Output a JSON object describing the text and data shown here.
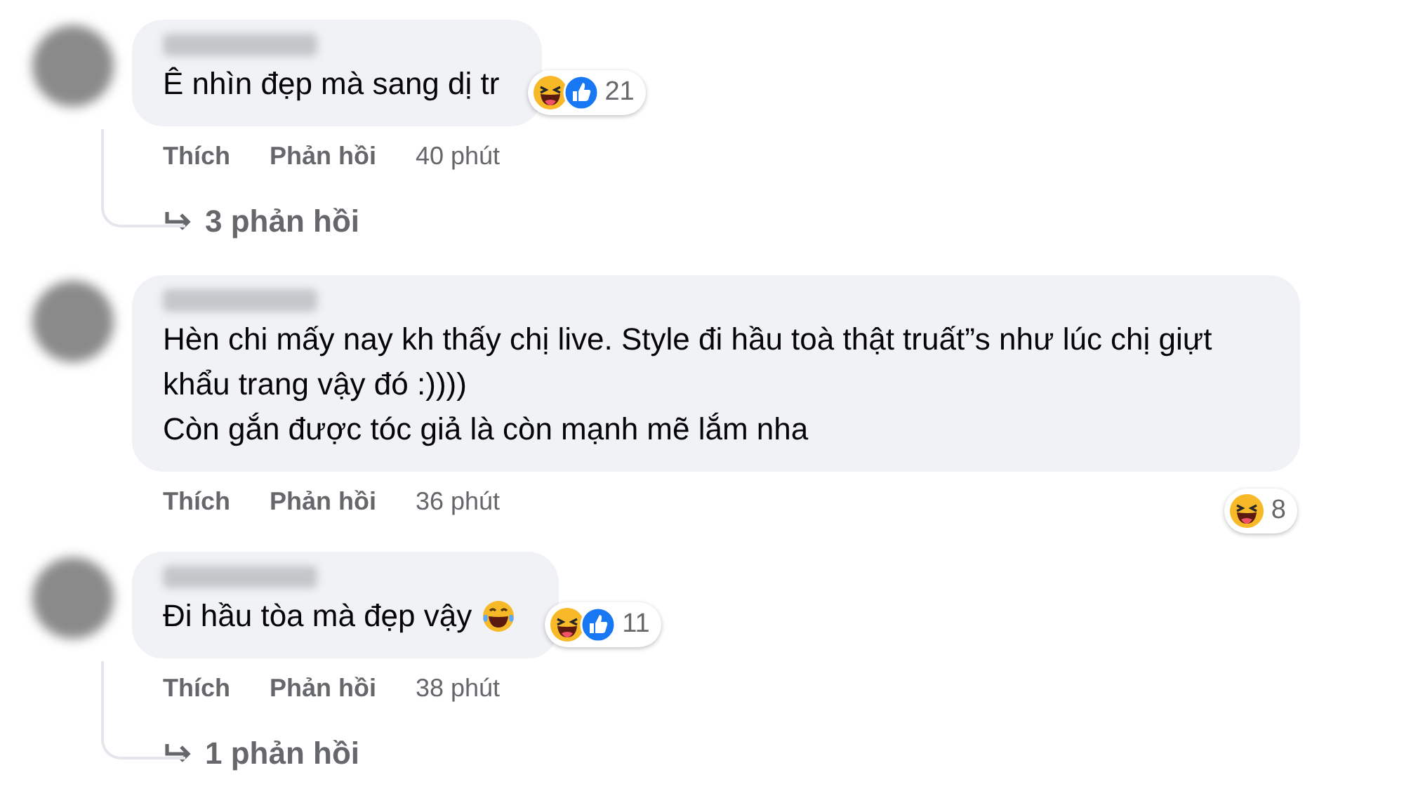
{
  "comments": [
    {
      "text": "Ê nhìn đẹp mà sang dị tr",
      "trailing_emoji": false,
      "reactions": [
        {
          "kind": "haha"
        },
        {
          "kind": "like"
        }
      ],
      "reaction_count": "21",
      "actions": [
        "Thích",
        "Phản hồi"
      ],
      "time": "40 phút",
      "replies": "3 phản hồi"
    },
    {
      "text": "Hèn chi mấy nay kh thấy chị live. Style đi hầu toà thật truất”s như lúc chị giựt khẩu trang vậy đó :))))\nCòn gắn được tóc giả là còn mạnh mẽ lắm nha",
      "trailing_emoji": false,
      "reactions": [
        {
          "kind": "haha"
        }
      ],
      "reaction_count": "8",
      "actions": [
        "Thích",
        "Phản hồi"
      ],
      "time": "36 phút"
    },
    {
      "text": "Đi hầu tòa mà đẹp vậy",
      "trailing_emoji": true,
      "reactions": [
        {
          "kind": "haha"
        },
        {
          "kind": "like"
        }
      ],
      "reaction_count": "11",
      "actions": [
        "Thích",
        "Phản hồi"
      ],
      "time": "38 phút",
      "replies": "1 phản hồi"
    }
  ]
}
